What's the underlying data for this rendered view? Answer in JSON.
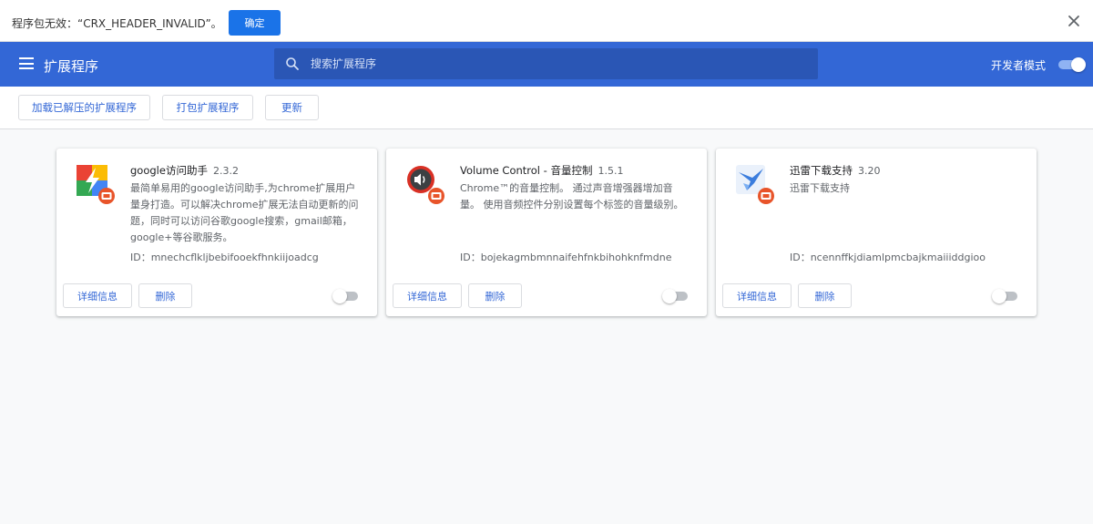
{
  "error_bar": {
    "message": "程序包无效：“CRX_HEADER_INVALID”。",
    "ok_label": "确定"
  },
  "header": {
    "title": "扩展程序",
    "search_placeholder": "搜索扩展程序",
    "dev_mode_label": "开发者模式",
    "dev_mode_on": true
  },
  "actions": {
    "load_unpacked": "加载已解压的扩展程序",
    "pack": "打包扩展程序",
    "update": "更新"
  },
  "extensions": [
    {
      "name": "google访问助手",
      "version": "2.3.2",
      "description": "最简单易用的google访问助手,为chrome扩展用户量身打造。可以解决chrome扩展无法自动更新的问题，同时可以访问谷歌google搜索，gmail邮箱，google+等谷歌服务。",
      "id": "ID：mnechcflkljbebifooekfhnkiijoadcg",
      "details_label": "详细信息",
      "remove_label": "删除",
      "enabled": false
    },
    {
      "name": "Volume Control - 音量控制",
      "version": "1.5.1",
      "description": "Chrome™的音量控制。 通过声音增强器增加音量。 使用音频控件分别设置每个标签的音量级别。",
      "id": "ID：bojekagmbmnnaifehfnkbihohknfmdne",
      "details_label": "详细信息",
      "remove_label": "删除",
      "enabled": false
    },
    {
      "name": "迅雷下载支持",
      "version": "3.20",
      "description": "迅雷下载支持",
      "id": "ID：ncennffkjdiamlpmcbajkmaiiiddgioo",
      "details_label": "详细信息",
      "remove_label": "删除",
      "enabled": false
    }
  ],
  "icons": {
    "close": "close-icon",
    "menu": "hamburger-menu-icon",
    "search": "search-icon",
    "ext1": "google-helper-icon",
    "ext2": "volume-control-icon",
    "ext3": "thunder-download-icon",
    "badge": "error-badge-icon"
  },
  "colors": {
    "toolbar": "#3367d6",
    "accent": "#1a73e8",
    "badge": "#e8542a"
  }
}
